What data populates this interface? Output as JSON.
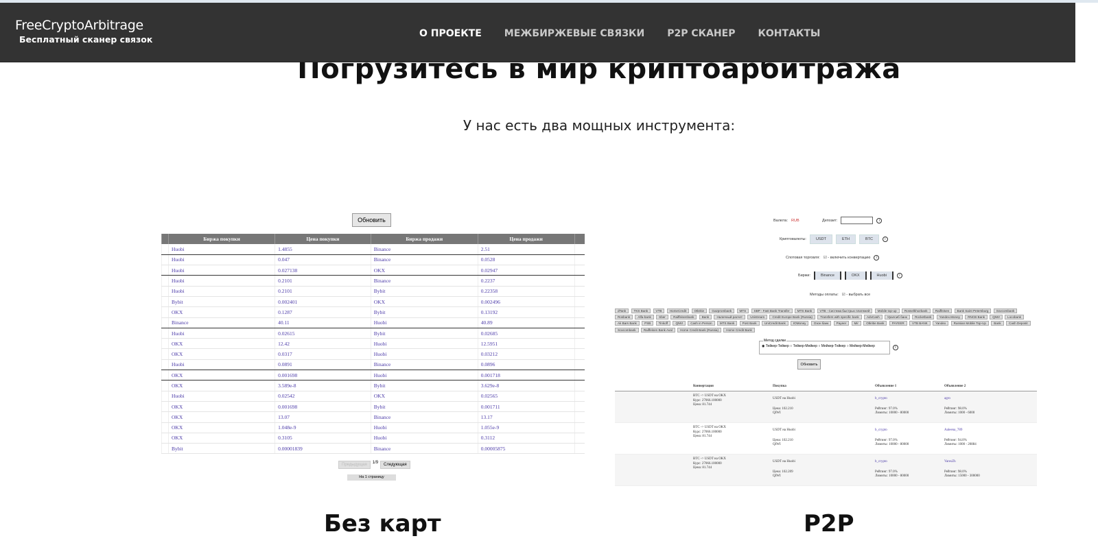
{
  "header": {
    "brand": "FreeCryptoArbitrage",
    "tagline": "Бесплатный сканер связок",
    "nav": [
      {
        "label": "О ПРОЕКТЕ",
        "active": true
      },
      {
        "label": "МЕЖБИРЖЕВЫЕ СВЯЗКИ"
      },
      {
        "label": "P2P СКАНЕР"
      },
      {
        "label": "КОНТАКТЫ"
      }
    ]
  },
  "hero": {
    "title": "Погрузитесь в мир криптоарбитража",
    "subtitle": "У нас есть два мощных инструмента:"
  },
  "tools": [
    {
      "caption": "Без карт"
    },
    {
      "caption": "P2P"
    }
  ],
  "cex": {
    "refresh": "Обновить",
    "columns": [
      "Биржа покупки",
      "Цена покупки",
      "Биржа продажи",
      "Цена продажи"
    ],
    "rows": [
      [
        "Huobi",
        "1.4855",
        "Binance",
        "2.51"
      ],
      [
        "Huobi",
        "0.047",
        "Binance",
        "0.0528"
      ],
      [
        "Huobi",
        "0.027138",
        "OKX",
        "0.02947"
      ],
      [
        "Huobi",
        "0.2101",
        "Binance",
        "0.2237"
      ],
      [
        "Huobi",
        "0.2101",
        "Bybit",
        "0.22358"
      ],
      [
        "Bybit",
        "0.002401",
        "OKX",
        "0.002496"
      ],
      [
        "OKX",
        "0.1287",
        "Bybit",
        "0.13192"
      ],
      [
        "Binance",
        "40.11",
        "Huobi",
        "40.89"
      ],
      [
        "Huobi",
        "0.02615",
        "Bybit",
        "0.02685"
      ],
      [
        "OKX",
        "12.42",
        "Huobi",
        "12.5951"
      ],
      [
        "OKX",
        "0.0317",
        "Huobi",
        "0.03212"
      ],
      [
        "Huobi",
        "0.0891",
        "Binance",
        "0.0896"
      ],
      [
        "OKX",
        "0.001698",
        "Huobi",
        "0.001718"
      ],
      [
        "OKX",
        "3.589e-8",
        "Bybit",
        "3.629e-8"
      ],
      [
        "Huobi",
        "0.02542",
        "OKX",
        "0.02565"
      ],
      [
        "OKX",
        "0.001698",
        "Bybit",
        "0.001711"
      ],
      [
        "OKX",
        "13.07",
        "Binance",
        "13.17"
      ],
      [
        "OKX",
        "1.048e-9",
        "Huobi",
        "1.055e-9"
      ],
      [
        "OKX",
        "0.3105",
        "Huobi",
        "0.3112"
      ],
      [
        "Bybit",
        "0.00001839",
        "Binance",
        "0.00005875"
      ]
    ],
    "prev": "Предыдущая",
    "page": "1/9",
    "next": "Следующая",
    "first": "На 1 страницу"
  },
  "p2p": {
    "currency_label": "Валюта:",
    "currency": "RUB",
    "deposit_label": "Депозит:",
    "crypto_label": "Криптовалюты:",
    "cryptos": [
      "USDT",
      "ETH",
      "BTC"
    ],
    "spot_label": "Спотовая торговля:",
    "spot_text": "☑ - включить конвертацию",
    "exchanges_label": "Биржи:",
    "exchanges": [
      "Binance",
      "OKX",
      "Huobi"
    ],
    "payments_label": "Методы оплаты:",
    "payments_text": "☑ - выбрать все",
    "banks": [
      "dTank",
      "TKS Bank",
      "VTB",
      "HomeCredit",
      "Otkritie",
      "Gazprombank",
      "MTS",
      "SBP - Fast Bank Transfer",
      "MTS Bank",
      "VTB - Система быстрых платежей",
      "Mobile top-up",
      "Rosselkhozbank",
      "Raiffeisen",
      "Bank Saint Petersburg",
      "Sovcombank",
      "Rosbank",
      "Alfa-bank",
      "Sber",
      "Raiffeisenbank",
      "Bank",
      "Наличный расчет",
      "Unistream",
      "Credit Europe Bank (Russia)",
      "Transfers with specific bank",
      "AdvCash",
      "Уралсиб банк",
      "Rocketbank",
      "Yandex.Money",
      "RNCB Bank",
      "QIWI",
      "Locobank",
      "Ak Bars Bank",
      "PSB",
      "Tinkoff",
      "QIWI",
      "Cash in Person",
      "MTS Bank",
      "Post Bank",
      "UniCredit Bank",
      "ЮMoney",
      "Озон банк",
      "Payeer",
      "Mir",
      "Otkritie Bank",
      "PAYEER",
      "VTB BANK",
      "Yandex",
      "Russian Mobile Top-Up",
      "Bank",
      "Cash Deposit",
      "Sovcombank",
      "Raiffeisen Bank Aval",
      "Home Credit Bank (Russia)",
      "Home Credit Bank"
    ],
    "method_label": "Метод сделки",
    "methods": [
      "Тейкер-Тейкер",
      "Тейкер-Мейкер",
      "Мейкер-Тейкер",
      "Мейкер-Мейкер"
    ],
    "refresh": "Обновить",
    "columns": [
      "Конвертация",
      "Покупка",
      "Объявление 1",
      "Объявление 2"
    ],
    "rows": [
      {
        "conv": [
          "BTC -> USDT на OKX",
          "Курс: 27066.100000",
          "Цена: 81.744"
        ],
        "buy": "USDT на Huobi",
        "buy_price": "Цена: 102.210",
        "buy_method": "QIWI",
        "ad1": "b_crypto",
        "ad1_rating": "Рейтинг: 97.0%",
        "ad1_limits": "Лимиты: 10000 - 80000",
        "ad2": "agro",
        "ad2_rating": "Рейтинг: 98.0%",
        "ad2_limits": "Лимиты: 1000 - 6000"
      },
      {
        "conv": [
          "BTC -> USDT на OKX",
          "Курс: 27066.100000",
          "Цена: 81.744"
        ],
        "buy": "USDT на Huobi",
        "buy_price": "Цена: 102.210",
        "buy_method": "QIWI",
        "ad1": "b_crypto",
        "ad1_rating": "Рейтинг: 97.0%",
        "ad1_limits": "Лимиты: 10000 - 80000",
        "ad2": "Aaleena_789",
        "ad2_rating": "Рейтинг: 94.0%",
        "ad2_limits": "Лимиты: 1000 - 20884"
      },
      {
        "conv": [
          "BTC -> USDT на OKX",
          "Курс: 27066.100000",
          "Цена: 81.744"
        ],
        "buy": "USDT на Huobi",
        "buy_price": "Цена: 102.209",
        "buy_method": "QIWI",
        "ad1": "b_crypto",
        "ad1_rating": "Рейтинг: 97.0%",
        "ad1_limits": "Лимиты: 10000 - 80000",
        "ad2": "VaresZh",
        "ad2_rating": "Рейтинг: 98.0%",
        "ad2_limits": "Лимиты: 15000 - 300000"
      }
    ]
  }
}
